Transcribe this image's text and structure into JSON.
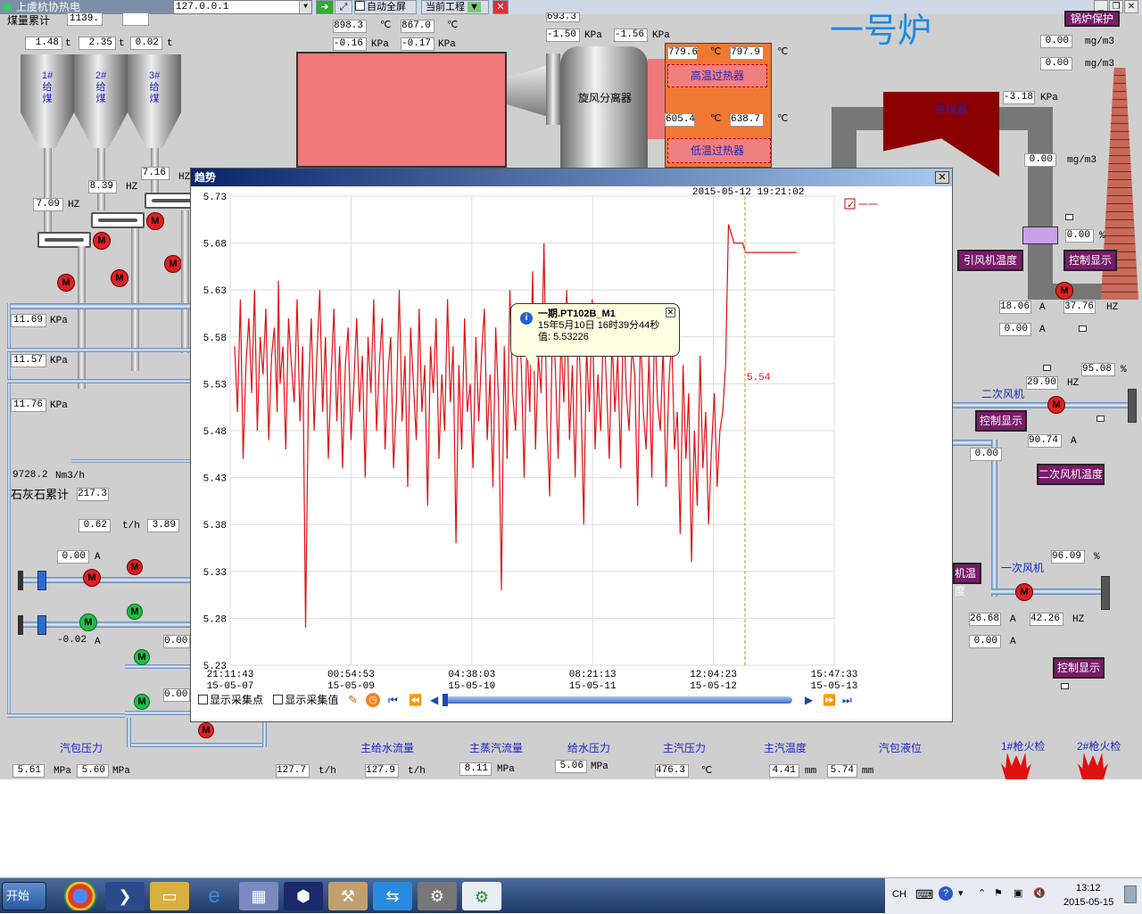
{
  "app": {
    "title": "上虞杭协热电",
    "ip_value": "127.0.0.1",
    "btn_fullscreen": "自动全屏",
    "btn_project": "当前工程",
    "big_title": "一号炉",
    "boiler_protect": "锅炉保护"
  },
  "top_values": {
    "coal_total_label": "煤量累计",
    "coal_total": "1139.",
    "coal_a": "1.48",
    "coal_b": "2.35",
    "coal_c": "0.02",
    "unit_t": "t",
    "temp1": "898.3",
    "temp2": "867.0",
    "unit_c": "℃",
    "press1": "-0.16",
    "press2": "-0.17",
    "unit_kpa": "KPa",
    "press3": "693.3",
    "press4": "-1.50",
    "press5": "-1.56",
    "sh_high_t1": "779.6",
    "sh_high_t2": "797.9",
    "sh_low_t1": "605.4",
    "sh_low_t2": "638.7",
    "high_sh_label": "高温过热器",
    "low_sh_label": "低温过热器",
    "separator_label": "旋风分离器",
    "economizer_label": "省煤器",
    "hz_a": "7.09",
    "hz_b": "8.39",
    "hz_c": "7.16",
    "unit_hz": "HZ",
    "emis1": "0.00",
    "emis2": "0.00",
    "emis3": "0.00",
    "unit_mgm3": "mg/m3",
    "flue_press": "-3.18",
    "damper": "0.00"
  },
  "bunkers": [
    {
      "label": "1#给煤"
    },
    {
      "label": "2#给煤"
    },
    {
      "label": "3#给煤"
    }
  ],
  "left_values": {
    "kpa1": "11.69",
    "kpa2": "11.57",
    "kpa3": "11.76",
    "flow": "9728.2",
    "flow_unit": "Nm3/h",
    "lime_label": "石灰石累计",
    "lime_total": "217.3",
    "lime_rate": "0.62",
    "lime_unit": "t/h",
    "lime_b": "3.89",
    "amp1": "0.00",
    "amp2": "-0.02",
    "unit_a": "A",
    "r1": "0.00",
    "r2": "0.00"
  },
  "right_values": {
    "id_fan_temp": "引风机温度",
    "ctrl_show": "控制显示",
    "id_amp": "18.06",
    "id_hz": "37.76",
    "id_amp2": "0.00",
    "sec_fan": "二次风机",
    "sec_hz": "29.90",
    "sec_pct": "95.08",
    "sec_amp": "90.74",
    "sec_val": "0.00",
    "sec_fan_temp": "二次风机温度",
    "pri_fan": "一次风机",
    "pri_pct": "96.09",
    "pri_amp": "26.68",
    "pri_hz": "42.26",
    "pri_amp2": "0.00",
    "pri_temp_frag": "机温度",
    "pct": "%"
  },
  "bottom": {
    "labels": [
      "汽包压力",
      "主给水流量",
      "主蒸汽流量",
      "给水压力",
      "主汽压力",
      "主汽温度",
      "汽包液位",
      "1#枪火检",
      "2#枪火检"
    ],
    "drum_p1": "5.61",
    "drum_p2": "5.60",
    "unit_mpa": "MPa",
    "feed_flow": "127.7",
    "steam_flow": "127.9",
    "unit_th": "t/h",
    "feed_press": "8.11",
    "main_press": "5.06",
    "main_temp": "476.3",
    "level1": "4.41",
    "level2": "5.74",
    "unit_mm": "mm"
  },
  "dialog": {
    "title": "趋势",
    "timestamp": "2015-05-12  19:21:02",
    "legend_name": "一一",
    "cursor_value": "5.54",
    "tooltip": {
      "tag": "一期.PT102B_M1",
      "time": "15年5月10日 16时39分44秒",
      "value_label": "值:",
      "value": "5.53226"
    },
    "show_points": "显示采集点",
    "show_values": "显示采集值"
  },
  "chart_data": {
    "type": "line",
    "title": "",
    "ylim": [
      5.23,
      5.73
    ],
    "yticks": [
      "5.73",
      "5.68",
      "5.63",
      "5.58",
      "5.53",
      "5.48",
      "5.43",
      "5.38",
      "5.33",
      "5.28",
      "5.23"
    ],
    "xticks": [
      {
        "time": "21:11:43",
        "date": "15-05-07"
      },
      {
        "time": "00:54:53",
        "date": "15-05-09"
      },
      {
        "time": "04:38:03",
        "date": "15-05-10"
      },
      {
        "time": "08:21:13",
        "date": "15-05-11"
      },
      {
        "time": "12:04:23",
        "date": "15-05-12"
      },
      {
        "time": "15:47:33",
        "date": "15-05-13"
      }
    ],
    "series": [
      {
        "color": "#e01010",
        "x_days": [
          0,
          0.05,
          0.1,
          0.15,
          0.2,
          0.25,
          0.3,
          0.35,
          0.4,
          0.45,
          0.5,
          0.55,
          0.6,
          0.65,
          0.7,
          0.75,
          0.77,
          0.8,
          0.85,
          0.9,
          0.95,
          1.0,
          1.05,
          1.1,
          1.15,
          1.2,
          1.25,
          1.3,
          1.35,
          1.4,
          1.45,
          1.5,
          1.55,
          1.6,
          1.65,
          1.7,
          1.75,
          1.8,
          1.85,
          1.9,
          1.95,
          2.0,
          2.05,
          2.1,
          2.15,
          2.2,
          2.25,
          2.3,
          2.35,
          2.4,
          2.45,
          2.5,
          2.55,
          2.6,
          2.65,
          2.7,
          2.75,
          2.8,
          2.85,
          2.9,
          2.95,
          3.0,
          3.05,
          3.1,
          3.15,
          3.2,
          3.25,
          3.3,
          3.35,
          3.4,
          3.45,
          3.5,
          3.55,
          3.6,
          3.65,
          3.7,
          3.75,
          3.8,
          3.85,
          3.9,
          3.95,
          4.0,
          4.05,
          4.1,
          4.15,
          4.2,
          4.25,
          4.3,
          4.35,
          4.4,
          4.45,
          4.5,
          4.55,
          4.6,
          4.65,
          4.7,
          4.75,
          4.8,
          4.85,
          4.9,
          4.95,
          5.0,
          5.05,
          5.1,
          5.15,
          5.2,
          5.25,
          5.3,
          5.35,
          5.4,
          5.45,
          5.5,
          5.55,
          5.6,
          5.65,
          5.7,
          5.75,
          5.8,
          5.85,
          5.9,
          5.95,
          6.0,
          6.05,
          6.1,
          6.15,
          6.2,
          6.25,
          6.3,
          6.35,
          6.4,
          6.45,
          6.5,
          6.55,
          6.6,
          6.65,
          6.7,
          6.75,
          6.8,
          6.85,
          6.9,
          6.95,
          7.0,
          7.05,
          7.1,
          7.15,
          7.2,
          7.25,
          7.3,
          7.35,
          7.4,
          7.45,
          7.5,
          7.55,
          7.6,
          7.65,
          7.7,
          7.75,
          7.8,
          7.85,
          7.9,
          7.95,
          8.0,
          8.05,
          8.1,
          8.15,
          8.2,
          8.25,
          8.3,
          8.35,
          8.4,
          8.45,
          8.5,
          8.55,
          8.6,
          8.65,
          8.7,
          8.75,
          8.8,
          8.85,
          8.9,
          8.95,
          9.0,
          9.05,
          9.1,
          9.15,
          9.2,
          9.25,
          9.3,
          9.35,
          9.4,
          9.45,
          9.5,
          9.55,
          9.6,
          9.65,
          9.7,
          9.75,
          9.8,
          9.85,
          9.9,
          9.95
        ],
        "values": [
          5.57,
          5.5,
          5.62,
          5.45,
          5.55,
          5.6,
          5.52,
          5.63,
          5.48,
          5.58,
          5.54,
          5.61,
          5.47,
          5.56,
          5.59,
          5.5,
          5.64,
          5.53,
          5.57,
          5.46,
          5.6,
          5.55,
          5.51,
          5.62,
          5.49,
          5.57,
          5.27,
          5.52,
          5.6,
          5.48,
          5.56,
          5.63,
          5.5,
          5.58,
          5.45,
          5.54,
          5.61,
          5.49,
          5.57,
          5.44,
          5.55,
          5.59,
          5.47,
          5.53,
          5.6,
          5.5,
          5.56,
          5.43,
          5.58,
          5.52,
          5.62,
          5.48,
          5.55,
          5.6,
          5.46,
          5.54,
          5.58,
          5.44,
          5.51,
          5.63,
          5.49,
          5.56,
          5.42,
          5.59,
          5.53,
          5.47,
          5.61,
          5.5,
          5.55,
          5.4,
          5.57,
          5.52,
          5.6,
          5.45,
          5.54,
          5.48,
          5.62,
          5.51,
          5.57,
          5.36,
          5.55,
          5.46,
          5.6,
          5.5,
          5.53,
          5.44,
          5.58,
          5.49,
          5.56,
          5.61,
          5.47,
          5.54,
          5.42,
          5.59,
          5.51,
          5.31,
          5.57,
          5.45,
          5.63,
          5.52,
          5.48,
          5.6,
          5.55,
          5.43,
          5.58,
          5.5,
          5.65,
          5.46,
          5.56,
          5.52,
          5.68,
          5.49,
          5.41,
          5.6,
          5.55,
          5.45,
          5.58,
          5.51,
          5.63,
          5.47,
          5.55,
          5.43,
          5.6,
          5.52,
          5.38,
          5.57,
          5.5,
          5.62,
          5.46,
          5.54,
          5.48,
          5.6,
          5.53,
          5.45,
          5.58,
          5.5,
          5.56,
          5.44,
          5.61,
          5.52,
          5.48,
          5.57,
          5.54,
          5.4,
          5.59,
          5.5,
          5.46,
          5.56,
          5.43,
          5.6,
          5.51,
          5.48,
          5.57,
          5.42,
          5.53,
          5.58,
          5.46,
          5.5,
          5.37,
          5.55,
          5.45,
          5.52,
          5.34,
          5.48,
          5.4,
          5.56,
          5.44,
          5.5,
          5.38,
          5.46,
          5.52,
          5.42,
          5.48,
          5.5,
          5.55,
          5.7,
          5.69,
          5.68,
          5.68,
          5.68,
          5.68,
          5.67,
          5.67,
          5.67,
          5.67,
          5.67,
          5.67,
          5.67,
          5.67,
          5.67,
          5.67,
          5.67,
          5.67,
          5.67,
          5.67,
          5.67,
          5.67,
          5.67,
          5.67,
          5.67
        ]
      }
    ]
  },
  "taskbar": {
    "start": "开始",
    "lang": "CH",
    "clock_time": "13:12",
    "clock_date": "2015-05-15"
  }
}
